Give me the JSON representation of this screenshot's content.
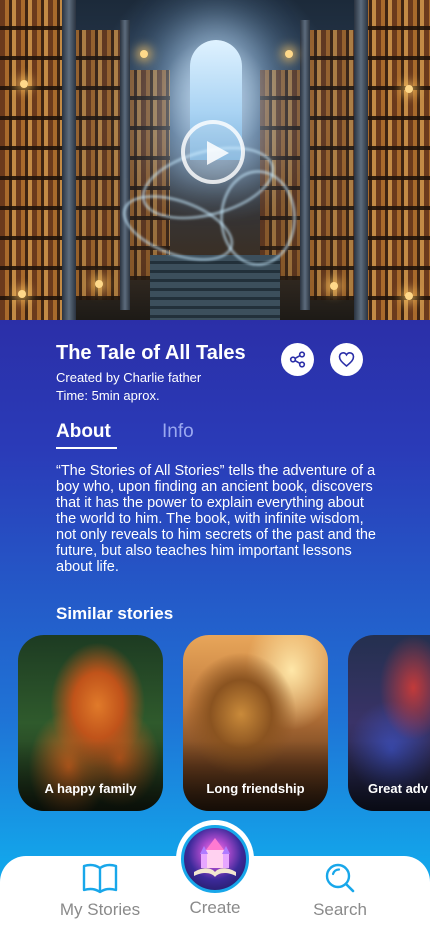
{
  "story": {
    "title": "The Tale of All Tales",
    "created_by": "Created by Charlie father",
    "time": "Time: 5min aprox."
  },
  "tabs": [
    {
      "label": "About",
      "active": true
    },
    {
      "label": "Info",
      "active": false
    }
  ],
  "about_text": "“The Stories of All Stories” tells the adventure of a boy who, upon finding an ancient book, discovers that it has the power to explain everything about the world to him. The book, with infinite wisdom, not only reveals to him secrets of the past and the future, but also teaches him important lessons about life.",
  "similar": {
    "title": "Similar stories",
    "items": [
      {
        "label": "A happy family"
      },
      {
        "label": "Long friendship"
      },
      {
        "label": "Great adv"
      }
    ]
  },
  "nav": {
    "items": [
      {
        "label": "My Stories",
        "icon": "book-icon"
      },
      {
        "label": "Create",
        "icon": "castle-book-icon"
      },
      {
        "label": "Search",
        "icon": "search-icon"
      }
    ]
  },
  "colors": {
    "accent": "#18a7ea",
    "background_top": "#2b2fa8",
    "background_bottom": "#0fb0f0"
  },
  "icons": {
    "play": "play-icon",
    "share": "share-icon",
    "favorite": "heart-icon"
  }
}
